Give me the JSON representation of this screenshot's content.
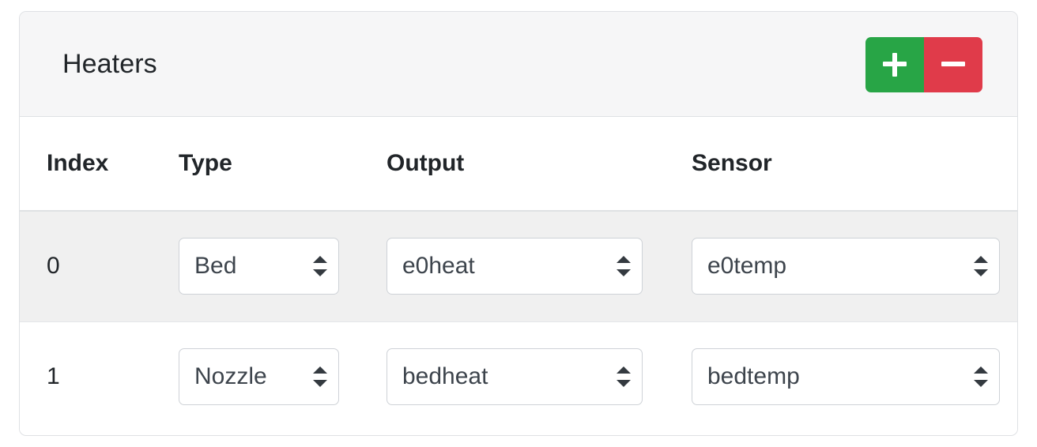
{
  "card": {
    "header": {
      "title": "Heaters",
      "add_button": {
        "label": "+",
        "icon": "plus-icon",
        "color": "#28a546"
      },
      "remove_button": {
        "label": "−",
        "icon": "minus-icon",
        "color": "#e03b4a"
      }
    },
    "table": {
      "columns": [
        "Index",
        "Type",
        "Output",
        "Sensor"
      ],
      "rows": [
        {
          "index": "0",
          "type": "Bed",
          "output": "e0heat",
          "sensor": "e0temp"
        },
        {
          "index": "1",
          "type": "Nozzle",
          "output": "bedheat",
          "sensor": "bedtemp"
        }
      ]
    }
  }
}
